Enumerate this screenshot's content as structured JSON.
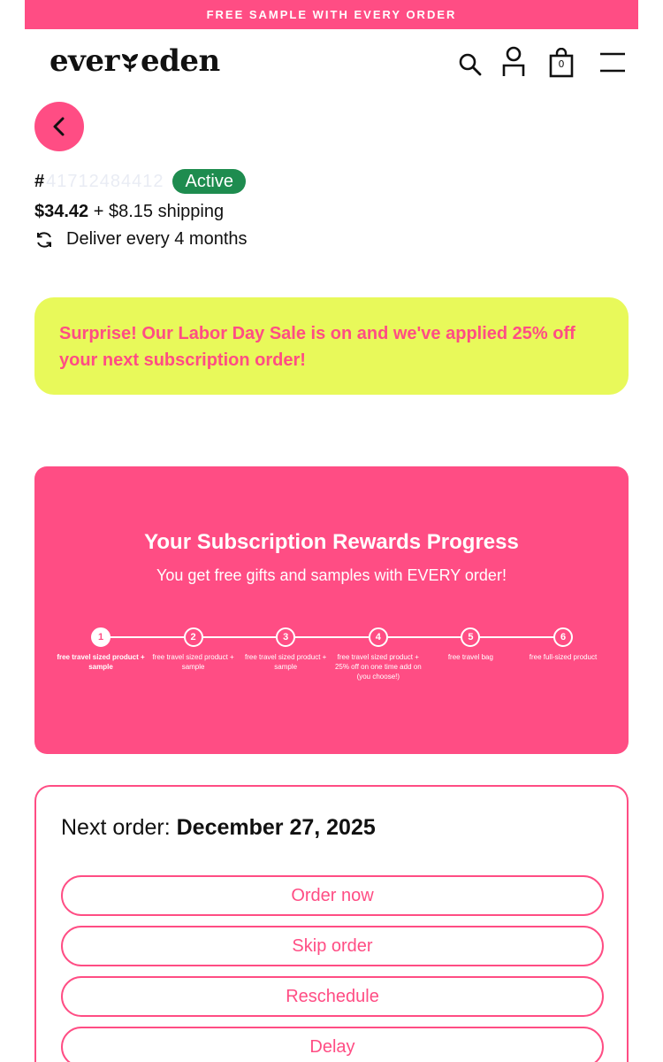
{
  "promo": {
    "text": "FREE SAMPLE WITH EVERY ORDER"
  },
  "header": {
    "logo_left": "ever",
    "logo_right": "eden",
    "icons": [
      "search-icon",
      "account-icon",
      "cart-icon",
      "menu-icon"
    ],
    "cart_count": "0"
  },
  "subscription": {
    "hash": "#",
    "id": "41712484412",
    "status": "Active",
    "price": "$34.42",
    "shipping": " + $8.15 shipping",
    "delivery": "Deliver every 4 months"
  },
  "sale_banner": {
    "text": "Surprise! Our Labor Day Sale is on and we've applied 25% off your next subscription order!"
  },
  "rewards": {
    "title": "Your Subscription Rewards Progress",
    "subtitle": "You get free gifts and samples with EVERY order!",
    "completed_steps": 1,
    "steps": [
      {
        "number": "1",
        "label": "free travel sized product + sample"
      },
      {
        "number": "2",
        "label": "free travel sized product + sample"
      },
      {
        "number": "3",
        "label": "free travel sized product + sample"
      },
      {
        "number": "4",
        "label": "free travel sized product + 25% off on one time add on (you choose!)"
      },
      {
        "number": "5",
        "label": "free travel bag"
      },
      {
        "number": "6",
        "label": "free full-sized product"
      }
    ]
  },
  "order": {
    "next_label": "Next order: ",
    "next_date": "December 27, 2025",
    "actions": [
      "Order now",
      "Skip order",
      "Reschedule",
      "Delay"
    ]
  },
  "colors": {
    "brand_pink": "#ff4d84",
    "banner_yellow": "#e8f95a",
    "active_green": "#1e8c4f"
  }
}
